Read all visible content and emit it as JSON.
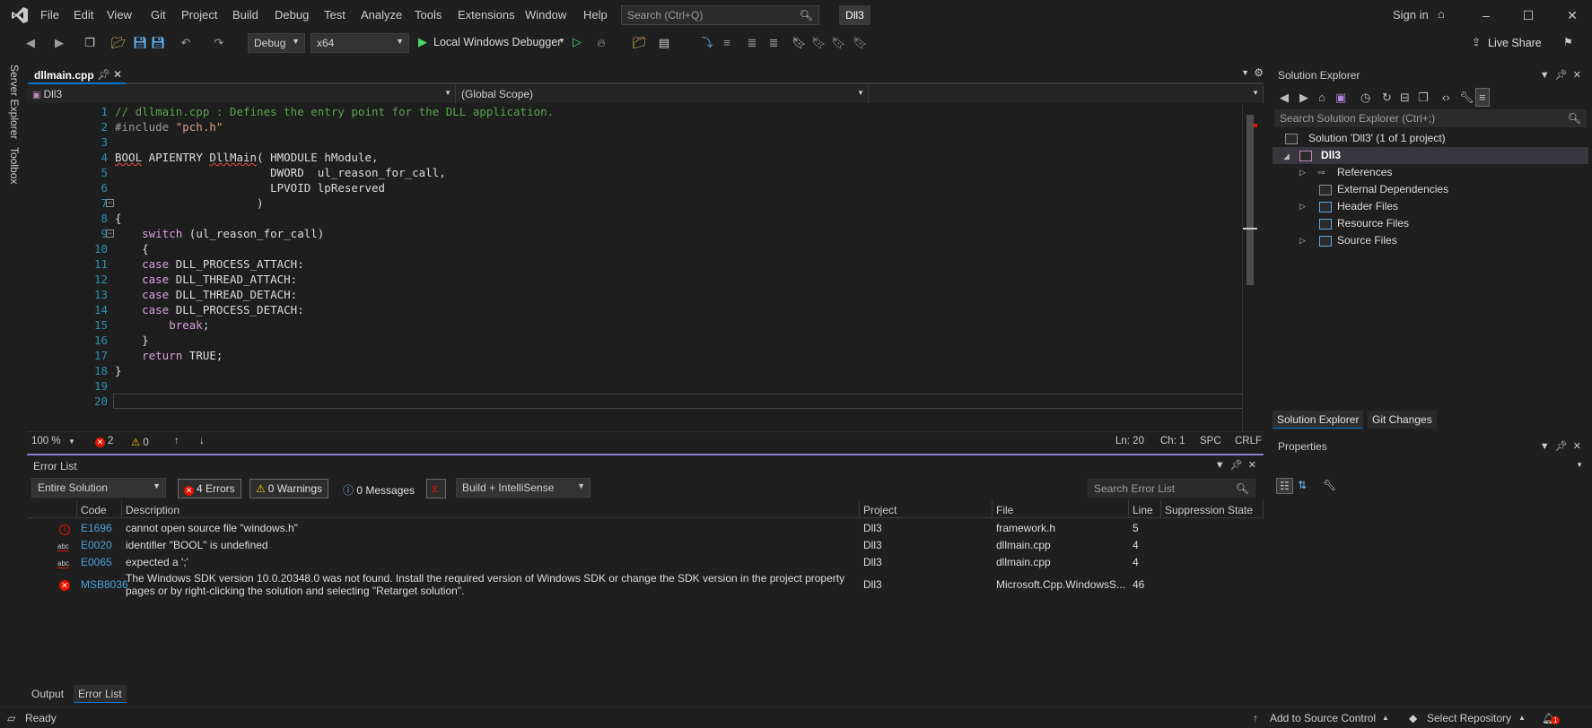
{
  "menu": {
    "items": [
      "File",
      "Edit",
      "View",
      "Git",
      "Project",
      "Build",
      "Debug",
      "Test",
      "Analyze",
      "Tools",
      "Extensions",
      "Window",
      "Help"
    ],
    "search_placeholder": "Search (Ctrl+Q)",
    "solution_badge": "Dll3",
    "sign_in": "Sign in"
  },
  "toolbar": {
    "config": "Debug",
    "platform": "x64",
    "debugger": "Local Windows Debugger",
    "live_share": "Live Share"
  },
  "sidebar_left": {
    "server_explorer": "Server Explorer",
    "toolbox": "Toolbox"
  },
  "editor": {
    "tab": "dllmain.cpp",
    "project_combo": "Dll3",
    "scope_combo": "(Global Scope)",
    "line_numbers": [
      "1",
      "2",
      "3",
      "4",
      "5",
      "6",
      "7",
      "8",
      "9",
      "10",
      "11",
      "12",
      "13",
      "14",
      "15",
      "16",
      "17",
      "18",
      "19",
      "20"
    ],
    "code": {
      "l1": "// dllmain.cpp : Defines the entry point for the DLL application.",
      "l2_pp": "#include ",
      "l2_str": "\"pch.h\"",
      "l4_type": "BOOL",
      "l4_mac": " APIENTRY ",
      "l4_fn": "DllMain",
      "l4_rest": "( HMODULE hModule,",
      "l5": "                       DWORD  ul_reason_for_call,",
      "l6": "                       LPVOID lpReserved",
      "l7": "                     )",
      "l8": "{",
      "l9_kw": "    switch",
      "l9_rest": " (ul_reason_for_call)",
      "l10": "    {",
      "l11_kw": "    case",
      "l11_rest": " DLL_PROCESS_ATTACH:",
      "l12_kw": "    case",
      "l12_rest": " DLL_THREAD_ATTACH:",
      "l13_kw": "    case",
      "l13_rest": " DLL_THREAD_DETACH:",
      "l14_kw": "    case",
      "l14_rest": " DLL_PROCESS_DETACH:",
      "l15_kw": "        break",
      "l15_rest": ";",
      "l16": "    }",
      "l17_kw": "    return",
      "l17_rest": " TRUE;",
      "l18": "}"
    },
    "status": {
      "zoom": "100 %",
      "errors": "2",
      "warnings": "0",
      "ln": "Ln: 20",
      "ch": "Ch: 1",
      "spc": "SPC",
      "crlf": "CRLF"
    }
  },
  "error_list": {
    "title": "Error List",
    "scope": "Entire Solution",
    "errors_btn": "4 Errors",
    "warnings_btn": "0 Warnings",
    "messages_btn": "0 Messages",
    "source_filter": "Build + IntelliSense",
    "search_placeholder": "Search Error List",
    "headers": {
      "code": "Code",
      "description": "Description",
      "project": "Project",
      "file": "File",
      "line": "Line",
      "suppression": "Suppression State"
    },
    "rows": [
      {
        "code": "E1696",
        "description": "cannot open source file \"windows.h\"",
        "description2": "",
        "project": "Dll3",
        "file": "framework.h",
        "line": "5"
      },
      {
        "code": "E0020",
        "description": "identifier \"BOOL\" is undefined",
        "description2": "",
        "project": "Dll3",
        "file": "dllmain.cpp",
        "line": "4"
      },
      {
        "code": "E0065",
        "description": "expected a ';'",
        "description2": "",
        "project": "Dll3",
        "file": "dllmain.cpp",
        "line": "4"
      },
      {
        "code": "MSB8036",
        "description": "The Windows SDK version 10.0.20348.0 was not found. Install the required version of Windows SDK or change the SDK version in the project property",
        "description2": "pages or by right-clicking the solution and selecting \"Retarget solution\".",
        "project": "Dll3",
        "file": "Microsoft.Cpp.WindowsS...",
        "line": "46"
      }
    ],
    "tabs": [
      "Output",
      "Error List"
    ]
  },
  "solution_explorer": {
    "title": "Solution Explorer",
    "search_placeholder": "Search Solution Explorer (Ctrl+;)",
    "solution": "Solution 'Dll3' (1 of 1 project)",
    "project": "Dll3",
    "items": [
      "References",
      "External Dependencies",
      "Header Files",
      "Resource Files",
      "Source Files"
    ],
    "tabs": [
      "Solution Explorer",
      "Git Changes"
    ]
  },
  "properties": {
    "title": "Properties"
  },
  "statusbar": {
    "ready": "Ready",
    "source_control": "Add to Source Control",
    "repository": "Select Repository",
    "notifications": "1"
  }
}
